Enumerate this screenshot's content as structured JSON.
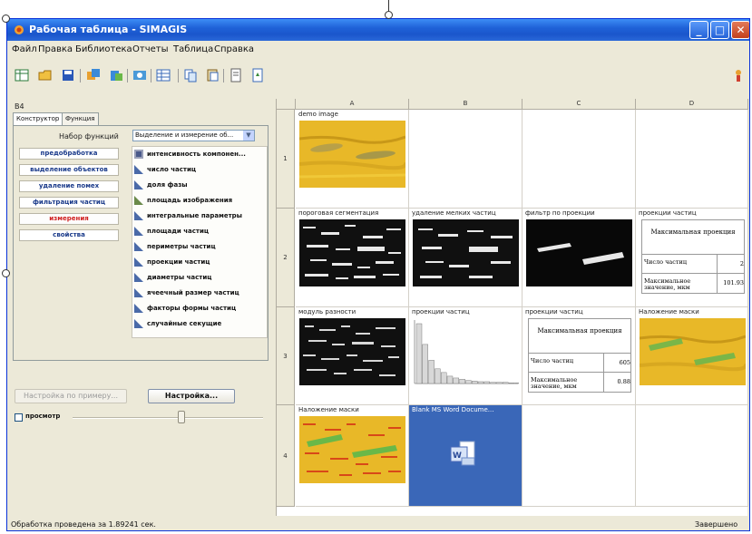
{
  "window": {
    "title": "Рабочая таблица - SIMAGIS"
  },
  "titlebar": {
    "min": "_",
    "max": "□",
    "close": "✕"
  },
  "menu": [
    "Файл",
    "Правка",
    "Библиотека",
    "Отчеты",
    "Таблица",
    "Справка"
  ],
  "toolbar": {
    "icons": [
      "table-icon",
      "open-icon",
      "save-icon",
      "copy-image-icon",
      "paste-image-icon",
      "process-icon",
      "grid-icon",
      "copy-icon",
      "paste-icon",
      "document-icon",
      "export-icon",
      "help-icon"
    ]
  },
  "left": {
    "cell_ref": "B4",
    "tabs": [
      "Конструктор",
      "Функция"
    ],
    "function_set_label": "Набор функций",
    "function_set_value": "Выделение и измерение об...",
    "categories": [
      "предобработка",
      "выделение объектов",
      "удаление помех",
      "фильтрация частиц",
      "измерения",
      "свойства"
    ],
    "functions": [
      "интенсивность компонен...",
      "число частиц",
      "доля фазы",
      "площадь изображения",
      "интегральные параметры",
      "площади частиц",
      "периметры частиц",
      "проекции частиц",
      "диаметры частиц",
      "ячеечный размер частиц",
      "факторы формы частиц",
      "случайные секущие"
    ],
    "tune_by_example": "Настройка по примеру...",
    "tune": "Настройка...",
    "preview": "просмотр"
  },
  "grid": {
    "columns": [
      "A",
      "B",
      "C",
      "D"
    ],
    "rows": [
      "1",
      "2",
      "3",
      "4"
    ],
    "cells": {
      "a1": "demo image",
      "a2": "пороговая сегментация",
      "b2": "удаление мелких частиц",
      "c2": "фильтр по проекции",
      "d2": "проекции частиц",
      "a3": "модуль разности",
      "b3": "проекции частиц",
      "c3": "проекции частиц",
      "d3": "Наложение маски",
      "a4": "Наложение маски",
      "b4": "Blank MS Word Docume..."
    },
    "table_d2": {
      "title": "Максимальная проекция",
      "rows": [
        {
          "name": "Число частиц",
          "value": "2"
        },
        {
          "name": "Максимальное значение, мкм",
          "value": "101.93"
        }
      ]
    },
    "table_c3": {
      "title": "Максимальная проекция",
      "rows": [
        {
          "name": "Число частиц",
          "value": "605"
        },
        {
          "name": "Максимальное значение, мкм",
          "value": "0.88"
        }
      ]
    }
  },
  "histogram": {
    "values": [
      98,
      64,
      38,
      24,
      18,
      12,
      9,
      7,
      5,
      4,
      3,
      3,
      2,
      2,
      2,
      1,
      1
    ]
  },
  "status": {
    "left": "Обработка проведена за 1.89241 сек.",
    "right": "Завершено"
  },
  "colors": {
    "title_bar": "#1f62d8",
    "selection": "#3a67b8",
    "active_category": "#d02020",
    "image_yellow": "#e8b828",
    "mask_green": "#7ab648"
  }
}
